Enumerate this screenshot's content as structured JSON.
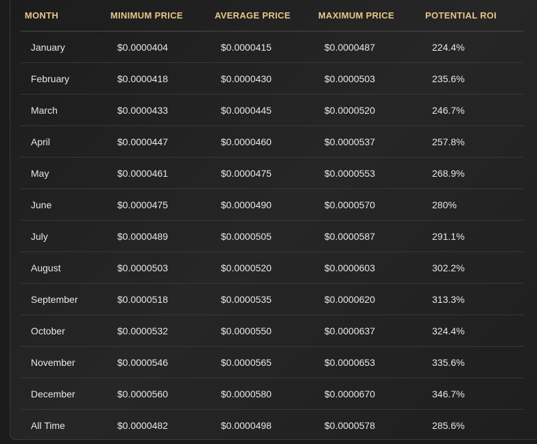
{
  "table": {
    "headers": [
      "MONTH",
      "MINIMUM PRICE",
      "AVERAGE PRICE",
      "MAXIMUM PRICE",
      "POTENTIAL ROI"
    ],
    "rows": [
      [
        "January",
        "$0.0000404",
        "$0.0000415",
        "$0.0000487",
        "224.4%"
      ],
      [
        "February",
        "$0.0000418",
        "$0.0000430",
        "$0.0000503",
        "235.6%"
      ],
      [
        "March",
        "$0.0000433",
        "$0.0000445",
        "$0.0000520",
        "246.7%"
      ],
      [
        "April",
        "$0.0000447",
        "$0.0000460",
        "$0.0000537",
        "257.8%"
      ],
      [
        "May",
        "$0.0000461",
        "$0.0000475",
        "$0.0000553",
        "268.9%"
      ],
      [
        "June",
        "$0.0000475",
        "$0.0000490",
        "$0.0000570",
        "280%"
      ],
      [
        "July",
        "$0.0000489",
        "$0.0000505",
        "$0.0000587",
        "291.1%"
      ],
      [
        "August",
        "$0.0000503",
        "$0.0000520",
        "$0.0000603",
        "302.2%"
      ],
      [
        "September",
        "$0.0000518",
        "$0.0000535",
        "$0.0000620",
        "313.3%"
      ],
      [
        "October",
        "$0.0000532",
        "$0.0000550",
        "$0.0000637",
        "324.4%"
      ],
      [
        "November",
        "$0.0000546",
        "$0.0000565",
        "$0.0000653",
        "335.6%"
      ],
      [
        "December",
        "$0.0000560",
        "$0.0000580",
        "$0.0000670",
        "346.7%"
      ],
      [
        "All Time",
        "$0.0000482",
        "$0.0000498",
        "$0.0000578",
        "285.6%"
      ]
    ]
  },
  "colors": {
    "header_text": "#e6c889",
    "cell_text": "#e8e8e8",
    "row_divider": "#383838",
    "background": "#1e1e1e"
  }
}
